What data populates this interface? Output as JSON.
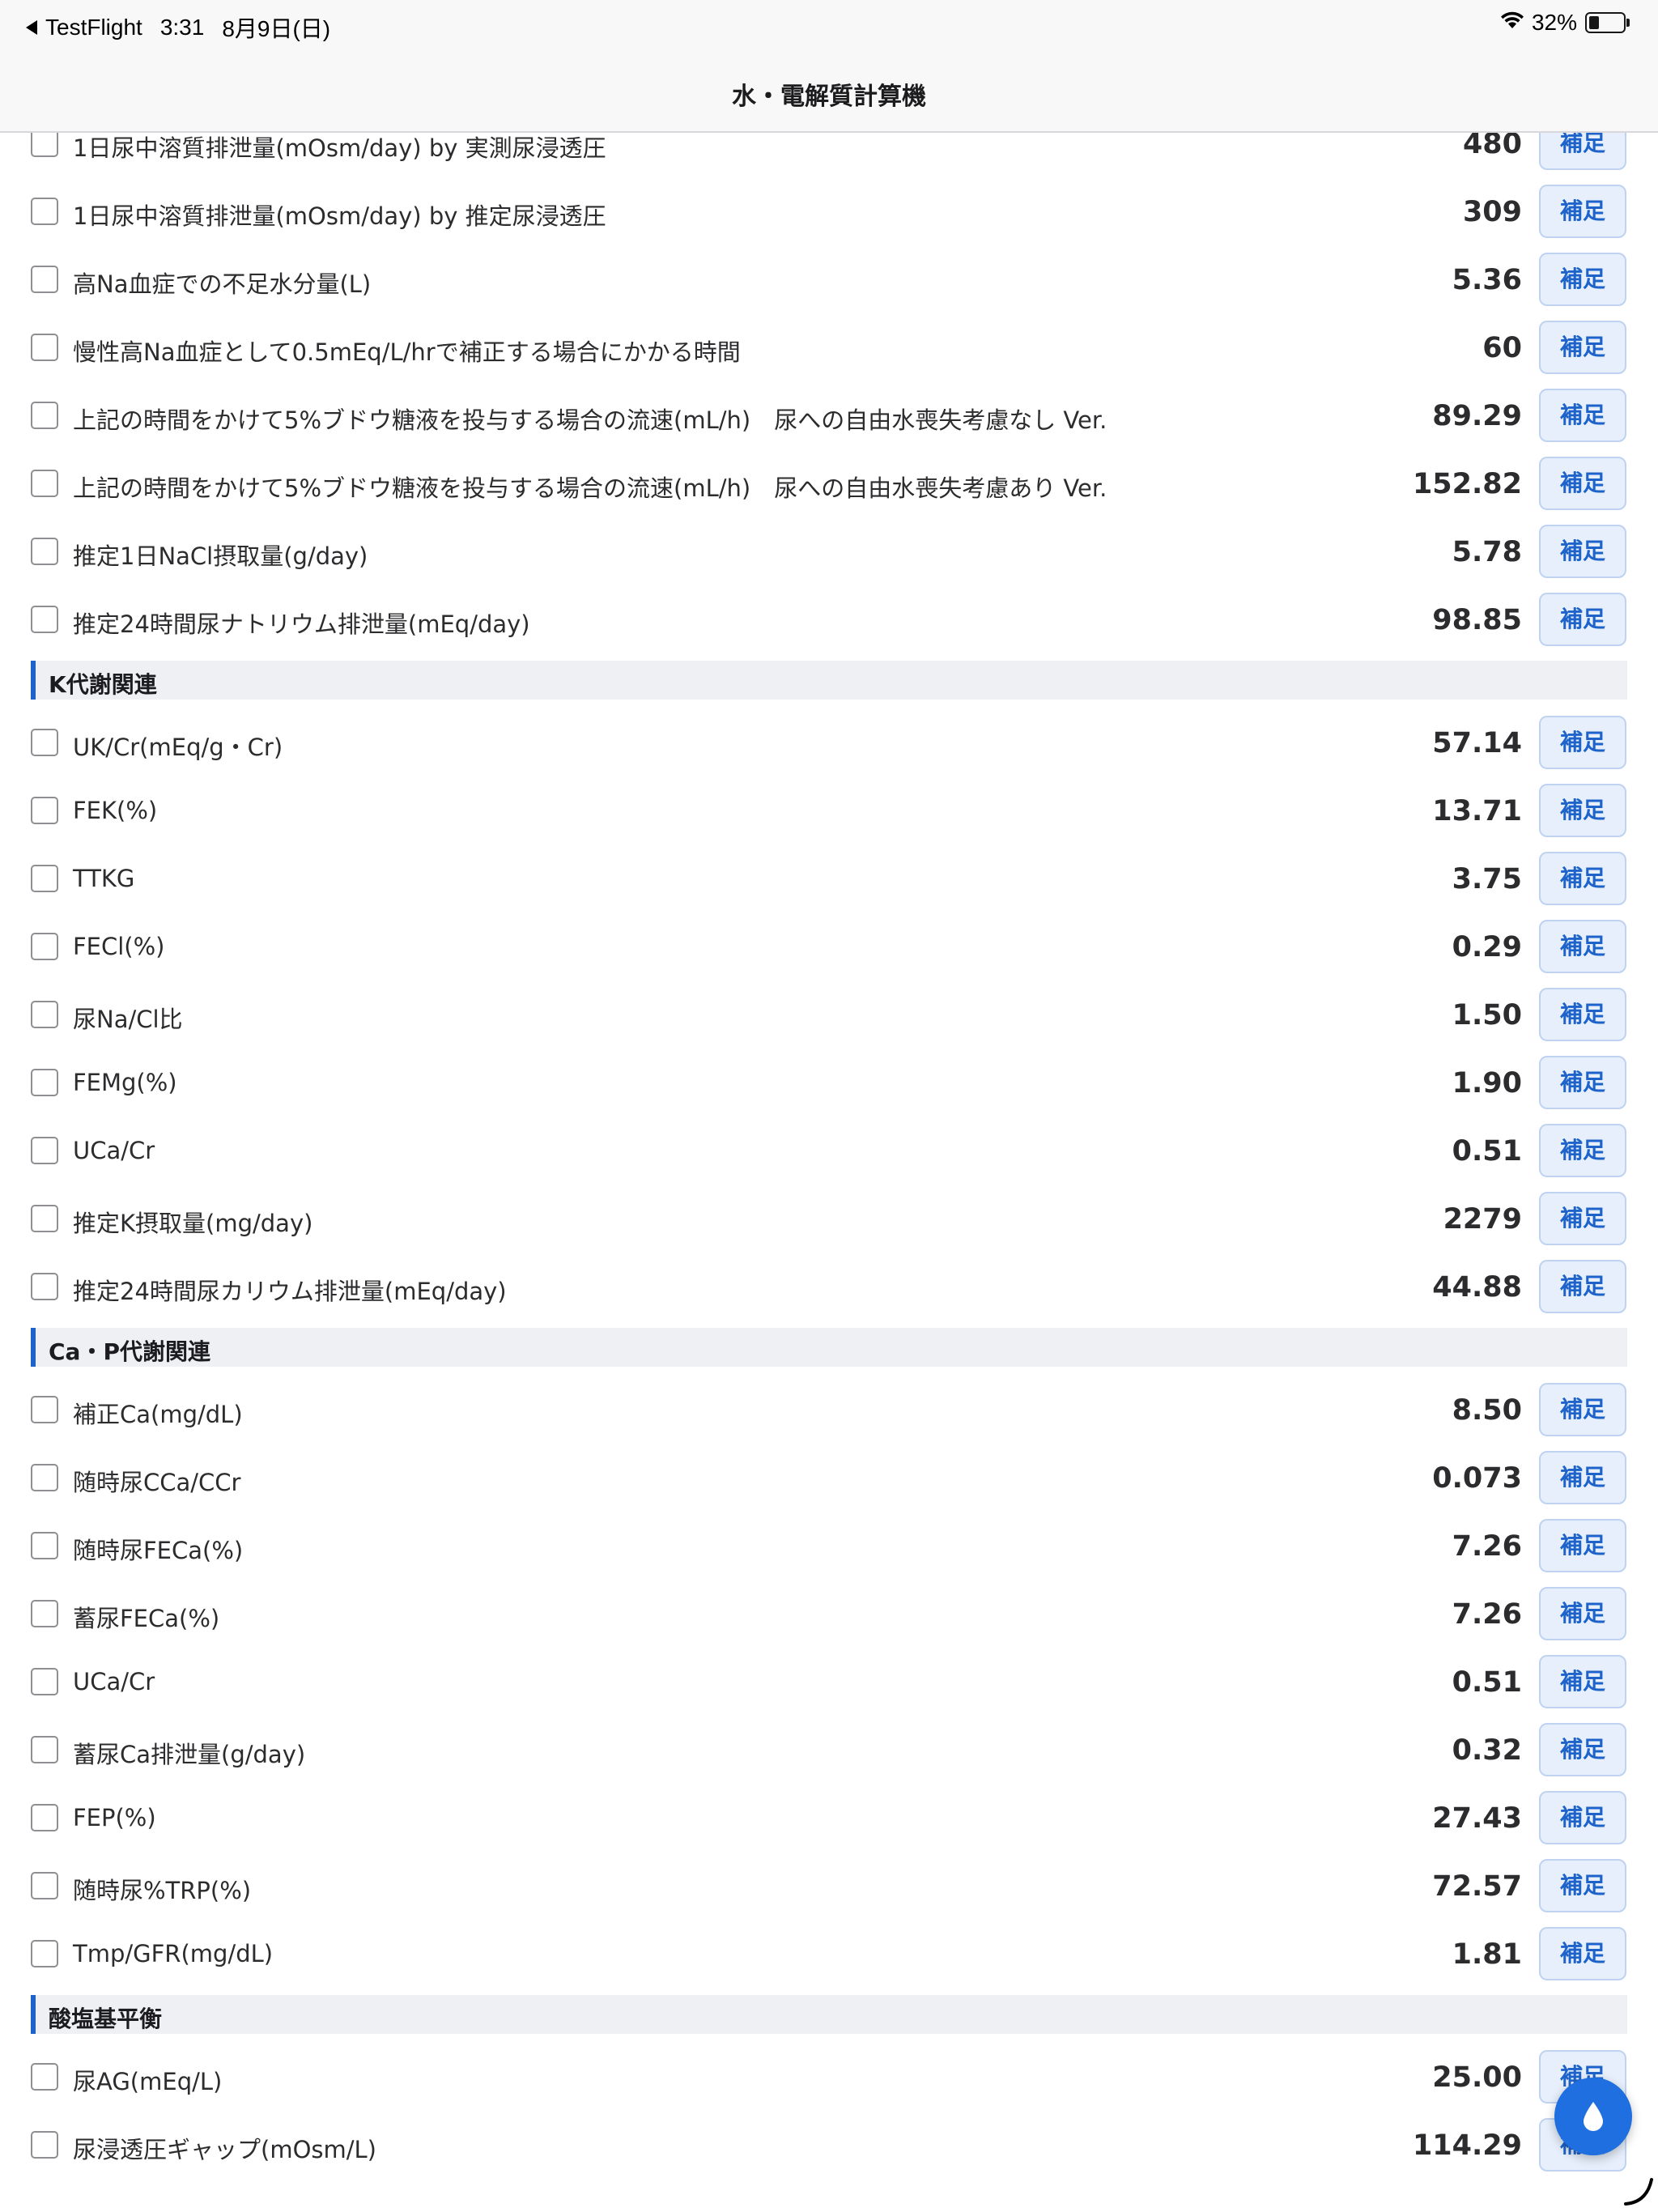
{
  "status_bar": {
    "app": "TestFlight",
    "time": "3:31",
    "date": "8月9日(日)",
    "battery": "32%",
    "battery_level": 0.32
  },
  "nav": {
    "title": "水・電解質計算機"
  },
  "support_label": "補足",
  "sections": [
    {
      "title": "",
      "rows": [
        {
          "label": "1日尿中溶質排泄量(mOsm/day) by 実測尿浸透圧",
          "value": "480"
        },
        {
          "label": "1日尿中溶質排泄量(mOsm/day) by 推定尿浸透圧",
          "value": "309"
        },
        {
          "label": "高Na血症での不足水分量(L)",
          "value": "5.36"
        },
        {
          "label": "慢性高Na血症として0.5mEq/L/hrで補正する場合にかかる時間",
          "value": "60"
        },
        {
          "label": "上記の時間をかけて5%ブドウ糖液を投与する場合の流速(mL/h)　尿への自由水喪失考慮なし Ver.",
          "value": "89.29"
        },
        {
          "label": "上記の時間をかけて5%ブドウ糖液を投与する場合の流速(mL/h)　尿への自由水喪失考慮あり Ver.",
          "value": "152.82"
        },
        {
          "label": "推定1日NaCl摂取量(g/day)",
          "value": "5.78"
        },
        {
          "label": "推定24時間尿ナトリウム排泄量(mEq/day)",
          "value": "98.85"
        }
      ]
    },
    {
      "title": "K代謝関連",
      "rows": [
        {
          "label": "UK/Cr(mEq/g・Cr)",
          "value": "57.14"
        },
        {
          "label": "FEK(%)",
          "value": "13.71"
        },
        {
          "label": "TTKG",
          "value": "3.75"
        },
        {
          "label": "FECl(%)",
          "value": "0.29"
        },
        {
          "label": "尿Na/Cl比",
          "value": "1.50"
        },
        {
          "label": "FEMg(%)",
          "value": "1.90"
        },
        {
          "label": "UCa/Cr",
          "value": "0.51"
        },
        {
          "label": "推定K摂取量(mg/day)",
          "value": "2279"
        },
        {
          "label": "推定24時間尿カリウム排泄量(mEq/day)",
          "value": "44.88"
        }
      ]
    },
    {
      "title": "Ca・P代謝関連",
      "rows": [
        {
          "label": "補正Ca(mg/dL)",
          "value": "8.50"
        },
        {
          "label": "随時尿CCa/CCr",
          "value": "0.073"
        },
        {
          "label": "随時尿FECa(%)",
          "value": "7.26"
        },
        {
          "label": "蓄尿FECa(%)",
          "value": "7.26"
        },
        {
          "label": "UCa/Cr",
          "value": "0.51"
        },
        {
          "label": "蓄尿Ca排泄量(g/day)",
          "value": "0.32"
        },
        {
          "label": "FEP(%)",
          "value": "27.43"
        },
        {
          "label": "随時尿%TRP(%)",
          "value": "72.57"
        },
        {
          "label": "Tmp/GFR(mg/dL)",
          "value": "1.81"
        }
      ]
    },
    {
      "title": "酸塩基平衡",
      "rows": [
        {
          "label": "尿AG(mEq/L)",
          "value": "25.00"
        },
        {
          "label": "尿浸透圧ギャップ(mOsm/L)",
          "value": "114.29"
        }
      ]
    }
  ],
  "colors": {
    "accent": "#1d63c9",
    "fab": "#1f6fe0",
    "section_bg": "#eef0f4",
    "button_bg": "#e6effb"
  },
  "icons": {
    "fab": "water-drop-icon",
    "back": "back-arrow-icon",
    "wifi": "wifi-icon",
    "battery": "battery-icon"
  }
}
